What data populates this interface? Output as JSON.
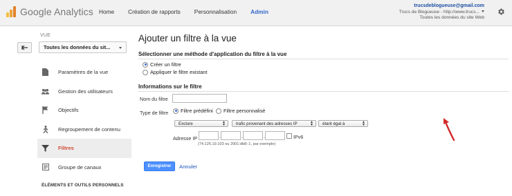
{
  "header": {
    "app_name": "Google Analytics",
    "nav": [
      "Home",
      "Création de rapports",
      "Personnalisation",
      "Admin"
    ],
    "active_nav": "Admin",
    "account": {
      "email": "trucsdeblogueuse@gmail.com",
      "property": "Trucs de Blogueuse - http://www.trucs...",
      "view": "Toutes les données du site Web"
    }
  },
  "sidebar": {
    "view_label": "VUE",
    "view_select": "Toutes les données du sit...",
    "items": [
      {
        "label": "Paramètres de la vue",
        "icon": "document-icon"
      },
      {
        "label": "Gestion des utilisateurs",
        "icon": "users-icon"
      },
      {
        "label": "Objectifs",
        "icon": "flag-icon"
      },
      {
        "label": "Regroupement de contenu",
        "icon": "person-walk-icon"
      },
      {
        "label": "Filtres",
        "icon": "funnel-icon",
        "active": true
      },
      {
        "label": "Groupe de canaux",
        "icon": "channel-group-icon"
      }
    ],
    "section_label": "ÉLÉMENTS ET OUTILS PERSONNELS"
  },
  "main": {
    "title": "Ajouter un filtre à la vue",
    "method_heading": "Sélectionner une méthode d'application du filtre à la vue",
    "method_options": [
      "Créer un filtre",
      "Appliquer le filtre existant"
    ],
    "method_selected": "Créer un filtre",
    "info_heading": "Informations sur le filtre",
    "filter_name_label": "Nom du filtre",
    "filter_name_value": "",
    "filter_type_label": "Type de filtre",
    "filter_type_options": [
      "Filtre prédéfini",
      "Filtre personnalisé"
    ],
    "filter_type_selected": "Filtre prédéfini",
    "predefined": {
      "action": "Exclure",
      "source": "trafic provenant des adresses IP",
      "operator": "étant égal à"
    },
    "ip": {
      "label": "Adresse IP",
      "octets": [
        "",
        "",
        "",
        ""
      ],
      "ipv6_label": "IPv6",
      "ipv6_checked": false,
      "example": "(74.125.19.103 ou 2001:db8::1, par exemple)"
    },
    "save_label": "Enregistrer",
    "cancel_label": "Annuler"
  },
  "colors": {
    "accent": "#3366cc",
    "active_menu": "#d14836",
    "primary_button": "#4d90fe",
    "annotation_arrow": "#d22b2b"
  }
}
